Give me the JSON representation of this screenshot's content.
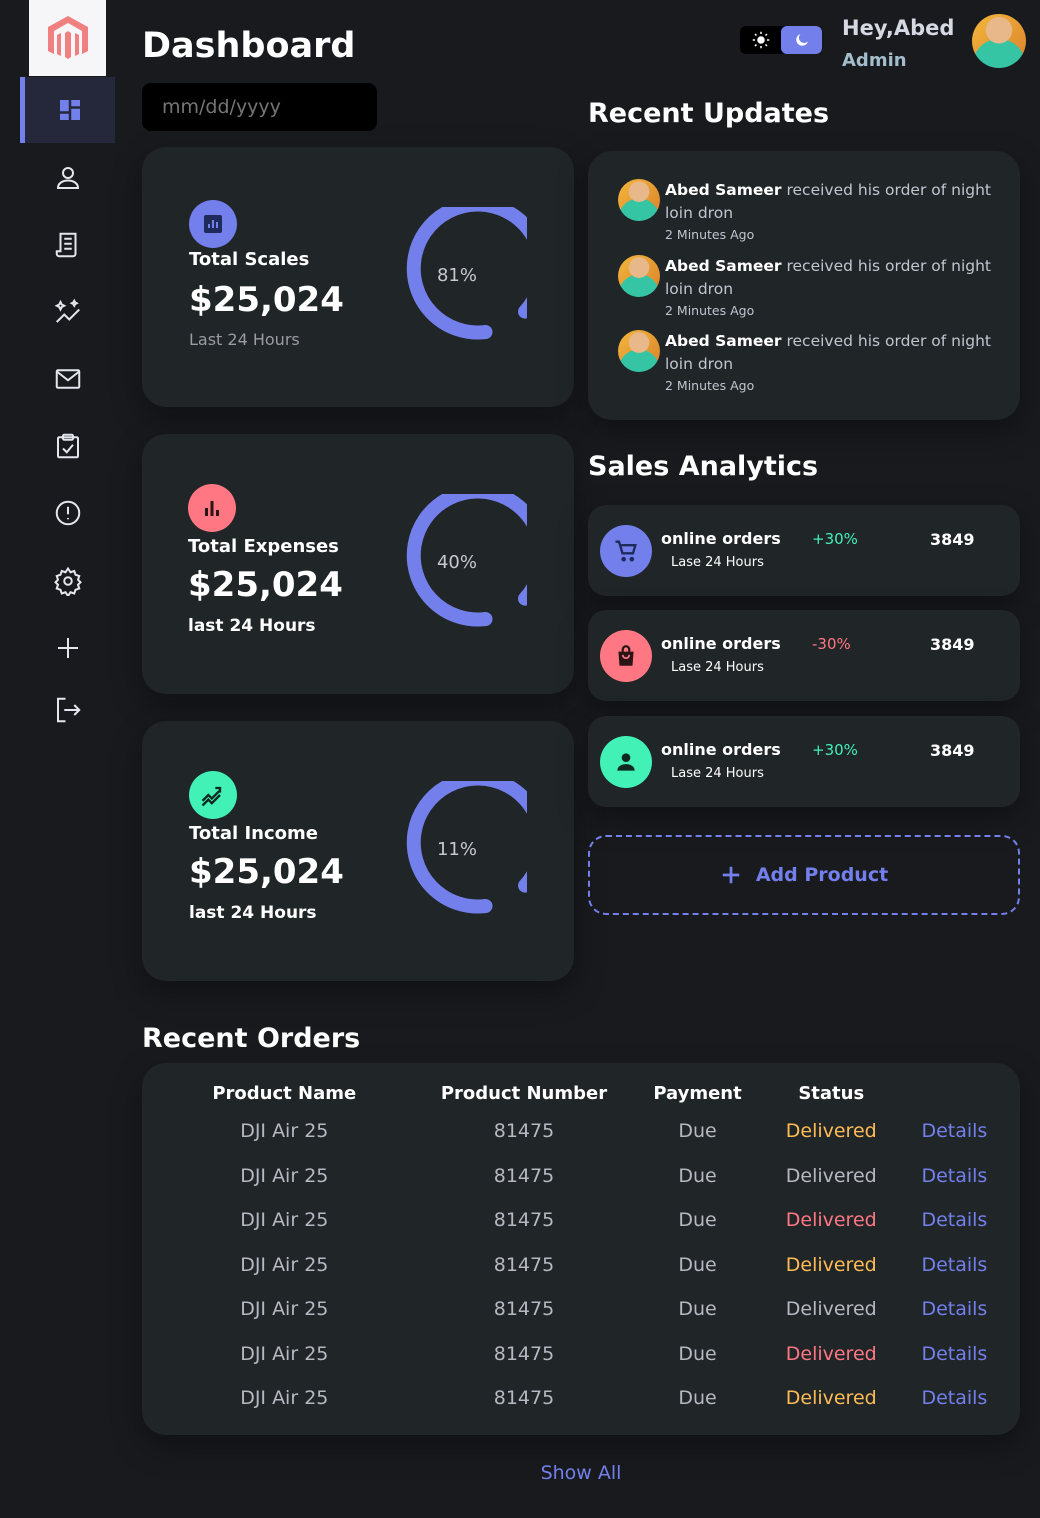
{
  "header": {
    "title": "Dashboard",
    "date_placeholder": "mm/dd/yyyy",
    "greeting": "Hey,Abed",
    "role": "Admin"
  },
  "sidebar": {
    "items": [
      {
        "icon": "dashboard-icon",
        "active": true
      },
      {
        "icon": "person-icon"
      },
      {
        "icon": "receipt-icon"
      },
      {
        "icon": "insights-icon"
      },
      {
        "icon": "mail-icon"
      },
      {
        "icon": "inventory-icon"
      },
      {
        "icon": "report-icon"
      },
      {
        "icon": "settings-icon"
      },
      {
        "icon": "add-icon"
      },
      {
        "icon": "logout-icon"
      }
    ]
  },
  "stats": [
    {
      "label": "Total Scales",
      "value": "$25,024",
      "sub": "Last 24 Hours",
      "percent": "81%",
      "color": "#7380ec"
    },
    {
      "label": "Total Expenses",
      "value": "$25,024",
      "sub": "last 24 Hours",
      "percent": "40%",
      "color": "#ff7782"
    },
    {
      "label": "Total Income",
      "value": "$25,024",
      "sub": "last 24 Hours",
      "percent": "11%",
      "color": "#41f1b6"
    }
  ],
  "updates": {
    "title": "Recent Updates",
    "items": [
      {
        "name": "Abed Sameer",
        "text": " received his order of night loin dron",
        "time": "2 Minutes Ago"
      },
      {
        "name": "Abed Sameer",
        "text": " received his order of night loin dron",
        "time": "2 Minutes Ago"
      },
      {
        "name": "Abed Sameer",
        "text": " received his order of night loin dron",
        "time": "2 Minutes Ago"
      }
    ]
  },
  "analytics": {
    "title": "Sales Analytics",
    "items": [
      {
        "title": "online orders",
        "sub": "Lase 24 Hours",
        "pct": "+30%",
        "count": "3849",
        "color": "#7380ec",
        "pct_color": "#41f1b6"
      },
      {
        "title": "online orders",
        "sub": "Lase 24 Hours",
        "pct": "-30%",
        "count": "3849",
        "color": "#ff7782",
        "pct_color": "#ff7782"
      },
      {
        "title": "online orders",
        "sub": "Lase 24 Hours",
        "pct": "+30%",
        "count": "3849",
        "color": "#41f1b6",
        "pct_color": "#41f1b6"
      }
    ],
    "add_product": "Add Product"
  },
  "orders": {
    "title": "Recent Orders",
    "columns": [
      "Product Name",
      "Product Number",
      "Payment",
      "Status",
      ""
    ],
    "rows": [
      {
        "name": "DJI Air 25",
        "number": "81475",
        "payment": "Due",
        "status": "Delivered",
        "status_color": "#ffbb55",
        "action": "Details"
      },
      {
        "name": "DJI Air 25",
        "number": "81475",
        "payment": "Due",
        "status": "Delivered",
        "status_color": "#b6b8c2",
        "action": "Details"
      },
      {
        "name": "DJI Air 25",
        "number": "81475",
        "payment": "Due",
        "status": "Delivered",
        "status_color": "#ff7782",
        "action": "Details"
      },
      {
        "name": "DJI Air 25",
        "number": "81475",
        "payment": "Due",
        "status": "Delivered",
        "status_color": "#ffbb55",
        "action": "Details"
      },
      {
        "name": "DJI Air 25",
        "number": "81475",
        "payment": "Due",
        "status": "Delivered",
        "status_color": "#b6b8c2",
        "action": "Details"
      },
      {
        "name": "DJI Air 25",
        "number": "81475",
        "payment": "Due",
        "status": "Delivered",
        "status_color": "#ff7782",
        "action": "Details"
      },
      {
        "name": "DJI Air 25",
        "number": "81475",
        "payment": "Due",
        "status": "Delivered",
        "status_color": "#ffbb55",
        "action": "Details"
      }
    ],
    "show_all": "Show All"
  },
  "colors": {
    "primary": "#7380ec",
    "danger": "#ff7782",
    "success": "#41f1b6",
    "warning": "#ffbb55"
  }
}
